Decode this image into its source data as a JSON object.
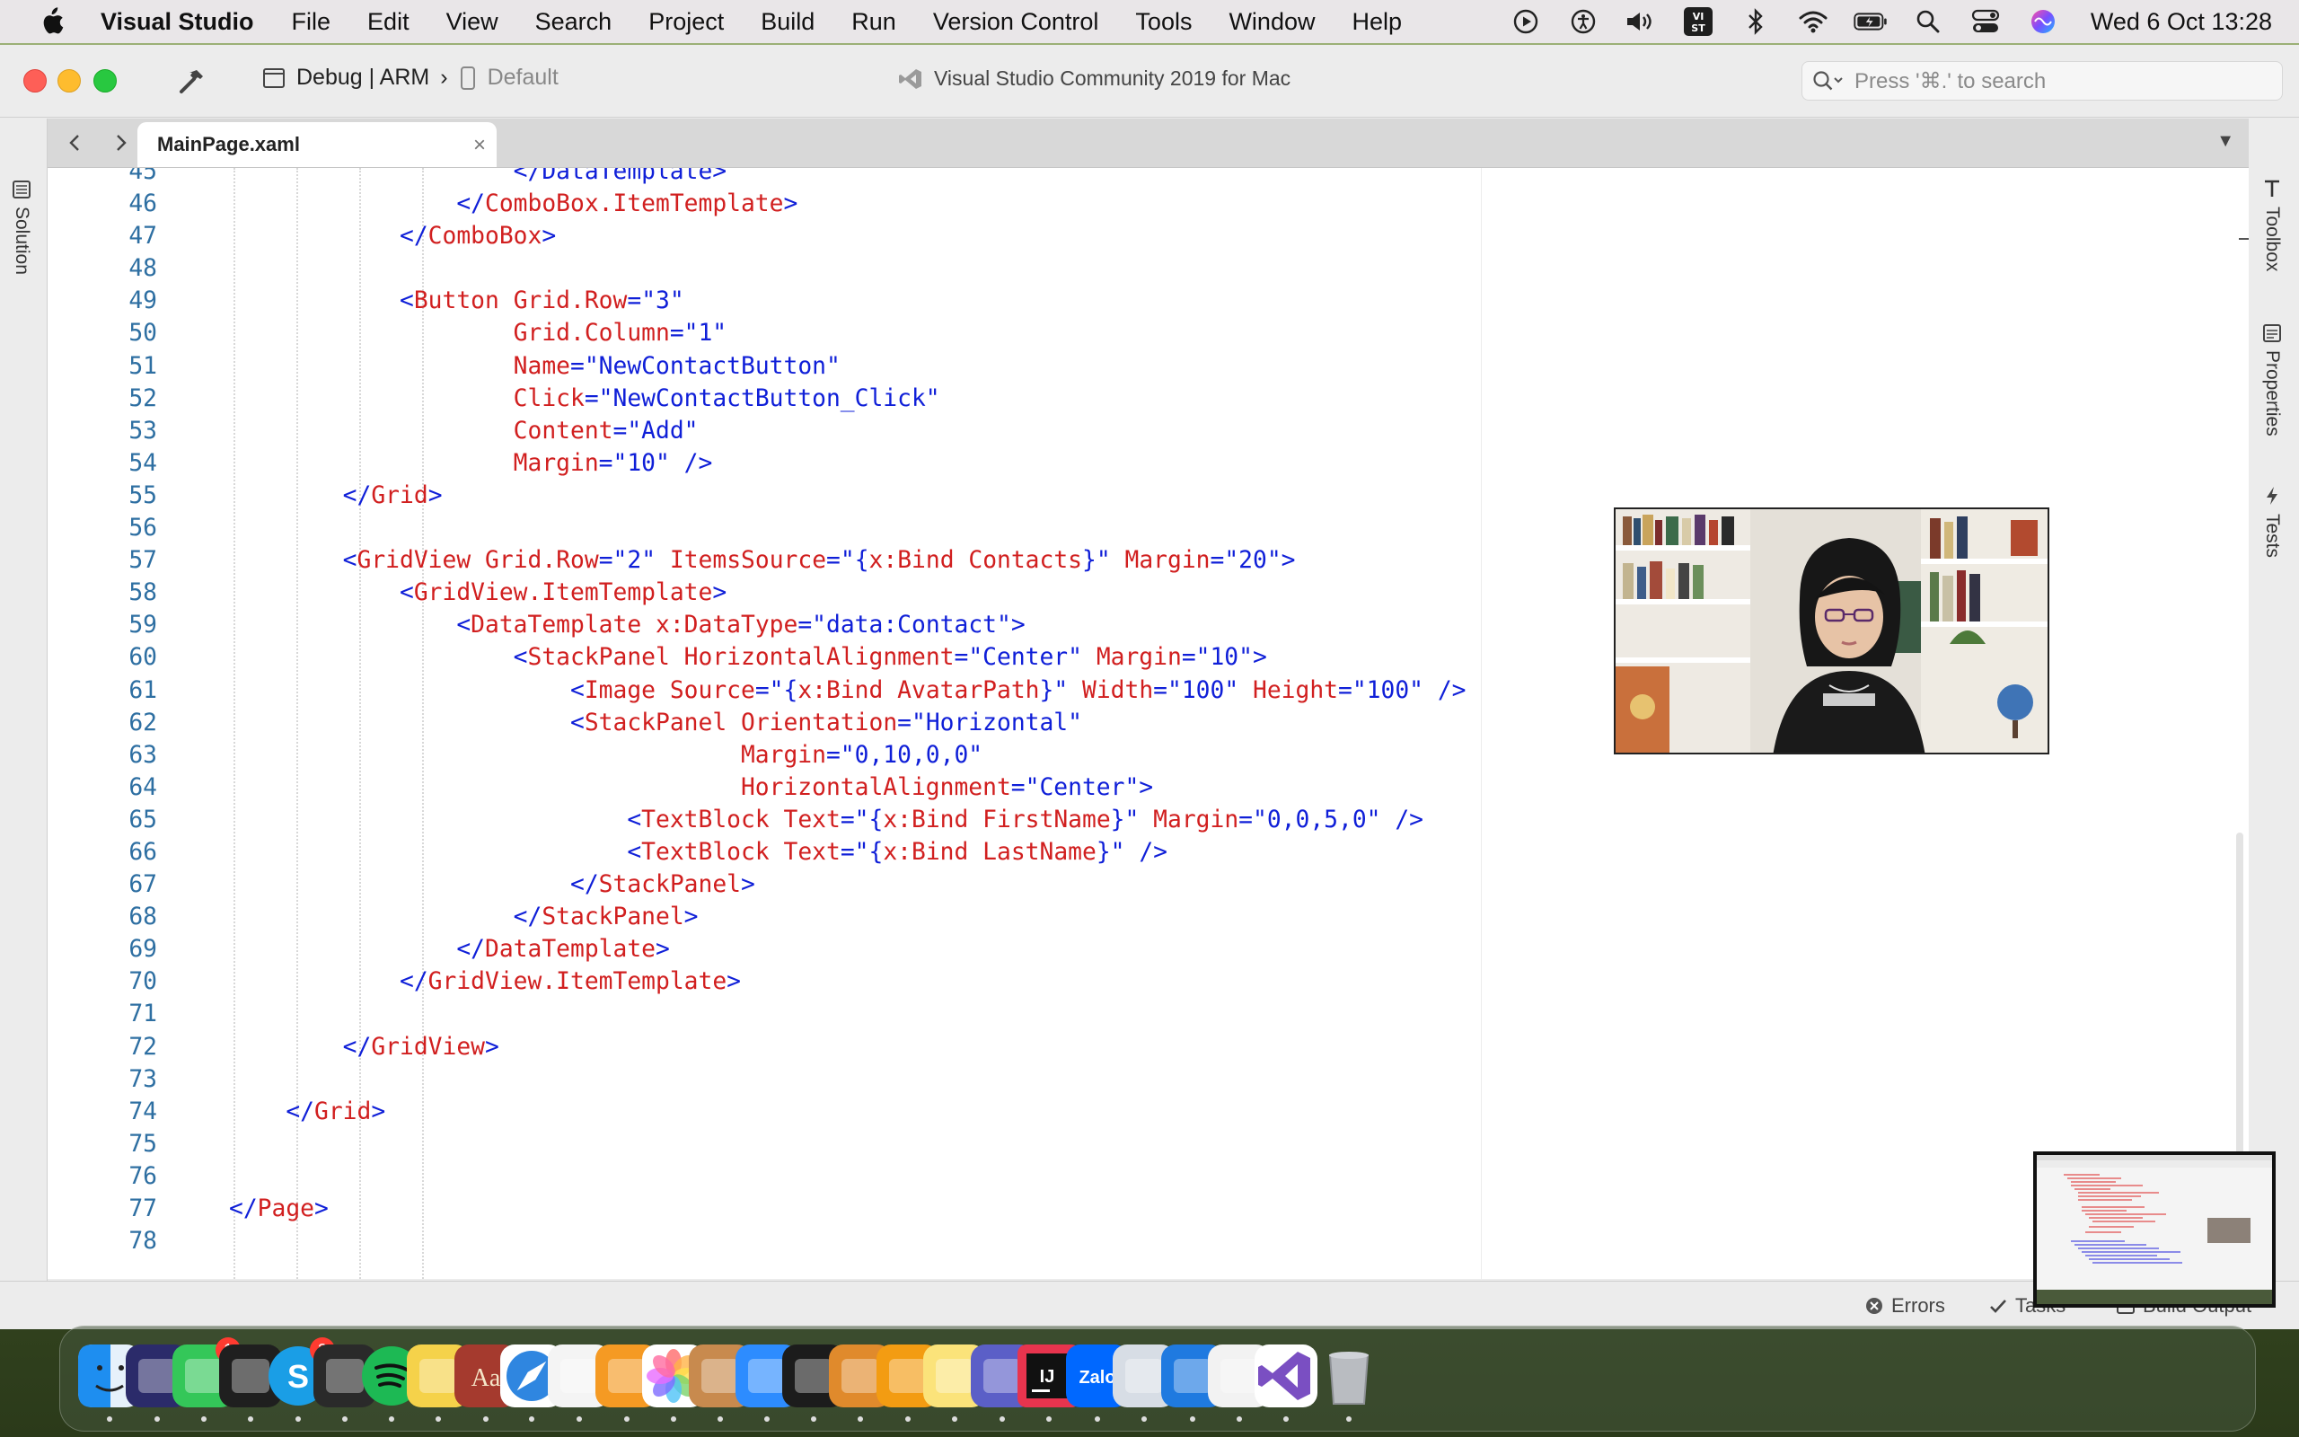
{
  "menubar": {
    "app_name": "Visual Studio",
    "items": [
      "File",
      "Edit",
      "View",
      "Search",
      "Project",
      "Build",
      "Run",
      "Version Control",
      "Tools",
      "Window",
      "Help"
    ],
    "status_icons": [
      "play-circle-icon",
      "accessibility-icon",
      "volume-icon",
      "vi-st-input-icon",
      "bluetooth-icon",
      "wifi-icon",
      "battery-icon",
      "spotlight-search-icon",
      "control-center-icon",
      "siri-icon"
    ],
    "input_badge": "VI\nST",
    "clock": "Wed 6 Oct  13:28"
  },
  "toolbar": {
    "configuration": "Debug | ARM",
    "config_arrow": "›",
    "device": "Default",
    "window_title": "Visual Studio Community 2019 for Mac",
    "search_placeholder": "Press '⌘.' to search"
  },
  "pads": {
    "left": "Solution",
    "right": [
      "Toolbox",
      "Properties",
      "Tests"
    ]
  },
  "tabs": {
    "active": "MainPage.xaml",
    "close_glyph": "×",
    "dropdown_glyph": "▼"
  },
  "editor": {
    "lines": [
      {
        "n": "45",
        "indent": 20,
        "tokens": [
          {
            "t": "tag",
            "s": "</DataTemplate>"
          }
        ]
      },
      {
        "n": "46",
        "indent": 16,
        "tokens": [
          {
            "t": "tag",
            "s": "</"
          },
          {
            "t": "attr",
            "s": "ComboBox.ItemTemplate"
          },
          {
            "t": "tag",
            "s": ">"
          }
        ]
      },
      {
        "n": "47",
        "indent": 12,
        "tokens": [
          {
            "t": "tag",
            "s": "</"
          },
          {
            "t": "attr",
            "s": "ComboBox"
          },
          {
            "t": "tag",
            "s": ">"
          }
        ]
      },
      {
        "n": "48",
        "indent": 0,
        "tokens": []
      },
      {
        "n": "49",
        "indent": 12,
        "tokens": [
          {
            "t": "tag",
            "s": "<"
          },
          {
            "t": "attr",
            "s": "Button"
          },
          {
            "t": "txt",
            "s": " "
          },
          {
            "t": "attr",
            "s": "Grid.Row"
          },
          {
            "t": "tag",
            "s": "=\"3\""
          }
        ]
      },
      {
        "n": "50",
        "indent": 20,
        "tokens": [
          {
            "t": "attr",
            "s": "Grid.Column"
          },
          {
            "t": "tag",
            "s": "=\"1\""
          }
        ]
      },
      {
        "n": "51",
        "indent": 20,
        "tokens": [
          {
            "t": "attr",
            "s": "Name"
          },
          {
            "t": "tag",
            "s": "=\"NewContactButton\""
          }
        ]
      },
      {
        "n": "52",
        "indent": 20,
        "tokens": [
          {
            "t": "attr",
            "s": "Click"
          },
          {
            "t": "tag",
            "s": "=\"NewContactButton_Click\""
          }
        ]
      },
      {
        "n": "53",
        "indent": 20,
        "tokens": [
          {
            "t": "attr",
            "s": "Content"
          },
          {
            "t": "tag",
            "s": "=\"Add\""
          }
        ]
      },
      {
        "n": "54",
        "indent": 20,
        "tokens": [
          {
            "t": "attr",
            "s": "Margin"
          },
          {
            "t": "tag",
            "s": "=\"10\" />"
          }
        ]
      },
      {
        "n": "55",
        "indent": 8,
        "tokens": [
          {
            "t": "tag",
            "s": "</"
          },
          {
            "t": "attr",
            "s": "Grid"
          },
          {
            "t": "tag",
            "s": ">"
          }
        ]
      },
      {
        "n": "56",
        "indent": 0,
        "tokens": []
      },
      {
        "n": "57",
        "indent": 8,
        "tokens": [
          {
            "t": "tag",
            "s": "<"
          },
          {
            "t": "attr",
            "s": "GridView"
          },
          {
            "t": "txt",
            "s": " "
          },
          {
            "t": "attr",
            "s": "Grid.Row"
          },
          {
            "t": "tag",
            "s": "=\"2\" "
          },
          {
            "t": "attr",
            "s": "ItemsSource"
          },
          {
            "t": "tag",
            "s": "=\"{"
          },
          {
            "t": "attr",
            "s": "x:Bind Contacts"
          },
          {
            "t": "tag",
            "s": "}\" "
          },
          {
            "t": "attr",
            "s": "Margin"
          },
          {
            "t": "tag",
            "s": "=\"20\">"
          }
        ]
      },
      {
        "n": "58",
        "indent": 12,
        "tokens": [
          {
            "t": "tag",
            "s": "<"
          },
          {
            "t": "attr",
            "s": "GridView.ItemTemplate"
          },
          {
            "t": "tag",
            "s": ">"
          }
        ]
      },
      {
        "n": "59",
        "indent": 16,
        "tokens": [
          {
            "t": "tag",
            "s": "<"
          },
          {
            "t": "attr",
            "s": "DataTemplate"
          },
          {
            "t": "txt",
            "s": " "
          },
          {
            "t": "attr",
            "s": "x:DataType"
          },
          {
            "t": "tag",
            "s": "=\"data:Contact\">"
          }
        ]
      },
      {
        "n": "60",
        "indent": 20,
        "tokens": [
          {
            "t": "tag",
            "s": "<"
          },
          {
            "t": "attr",
            "s": "StackPanel"
          },
          {
            "t": "txt",
            "s": " "
          },
          {
            "t": "attr",
            "s": "HorizontalAlignment"
          },
          {
            "t": "tag",
            "s": "=\"Center\" "
          },
          {
            "t": "attr",
            "s": "Margin"
          },
          {
            "t": "tag",
            "s": "=\"10\">"
          }
        ]
      },
      {
        "n": "61",
        "indent": 24,
        "tokens": [
          {
            "t": "tag",
            "s": "<"
          },
          {
            "t": "attr",
            "s": "Image"
          },
          {
            "t": "txt",
            "s": " "
          },
          {
            "t": "attr",
            "s": "Source"
          },
          {
            "t": "tag",
            "s": "=\"{"
          },
          {
            "t": "attr",
            "s": "x:Bind AvatarPath"
          },
          {
            "t": "tag",
            "s": "}\" "
          },
          {
            "t": "attr",
            "s": "Width"
          },
          {
            "t": "tag",
            "s": "=\"100\" "
          },
          {
            "t": "attr",
            "s": "Height"
          },
          {
            "t": "tag",
            "s": "=\"100\" />"
          }
        ]
      },
      {
        "n": "62",
        "indent": 24,
        "tokens": [
          {
            "t": "tag",
            "s": "<"
          },
          {
            "t": "attr",
            "s": "StackPanel"
          },
          {
            "t": "txt",
            "s": " "
          },
          {
            "t": "attr",
            "s": "Orientation"
          },
          {
            "t": "tag",
            "s": "=\"Horizontal\""
          }
        ]
      },
      {
        "n": "63",
        "indent": 36,
        "tokens": [
          {
            "t": "attr",
            "s": "Margin"
          },
          {
            "t": "tag",
            "s": "=\"0,10,0,0\""
          }
        ]
      },
      {
        "n": "64",
        "indent": 36,
        "tokens": [
          {
            "t": "attr",
            "s": "HorizontalAlignment"
          },
          {
            "t": "tag",
            "s": "=\"Center\">"
          }
        ]
      },
      {
        "n": "65",
        "indent": 28,
        "tokens": [
          {
            "t": "tag",
            "s": "<"
          },
          {
            "t": "attr",
            "s": "TextBlock"
          },
          {
            "t": "txt",
            "s": " "
          },
          {
            "t": "attr",
            "s": "Text"
          },
          {
            "t": "tag",
            "s": "=\"{"
          },
          {
            "t": "attr",
            "s": "x:Bind FirstName"
          },
          {
            "t": "tag",
            "s": "}\" "
          },
          {
            "t": "attr",
            "s": "Margin"
          },
          {
            "t": "tag",
            "s": "=\"0,0,5,0\" />"
          }
        ]
      },
      {
        "n": "66",
        "indent": 28,
        "tokens": [
          {
            "t": "tag",
            "s": "<"
          },
          {
            "t": "attr",
            "s": "TextBlock"
          },
          {
            "t": "txt",
            "s": " "
          },
          {
            "t": "attr",
            "s": "Text"
          },
          {
            "t": "tag",
            "s": "=\"{"
          },
          {
            "t": "attr",
            "s": "x:Bind LastName"
          },
          {
            "t": "tag",
            "s": "}\" />"
          }
        ]
      },
      {
        "n": "67",
        "indent": 24,
        "tokens": [
          {
            "t": "tag",
            "s": "</"
          },
          {
            "t": "attr",
            "s": "StackPanel"
          },
          {
            "t": "tag",
            "s": ">"
          }
        ]
      },
      {
        "n": "68",
        "indent": 20,
        "tokens": [
          {
            "t": "tag",
            "s": "</"
          },
          {
            "t": "attr",
            "s": "StackPanel"
          },
          {
            "t": "tag",
            "s": ">"
          }
        ]
      },
      {
        "n": "69",
        "indent": 16,
        "tokens": [
          {
            "t": "tag",
            "s": "</"
          },
          {
            "t": "attr",
            "s": "DataTemplate"
          },
          {
            "t": "tag",
            "s": ">"
          }
        ]
      },
      {
        "n": "70",
        "indent": 12,
        "tokens": [
          {
            "t": "tag",
            "s": "</"
          },
          {
            "t": "attr",
            "s": "GridView.ItemTemplate"
          },
          {
            "t": "tag",
            "s": ">"
          }
        ]
      },
      {
        "n": "71",
        "indent": 0,
        "tokens": []
      },
      {
        "n": "72",
        "indent": 8,
        "tokens": [
          {
            "t": "tag",
            "s": "</"
          },
          {
            "t": "attr",
            "s": "GridView"
          },
          {
            "t": "tag",
            "s": ">"
          }
        ]
      },
      {
        "n": "73",
        "indent": 0,
        "tokens": []
      },
      {
        "n": "74",
        "indent": 4,
        "tokens": [
          {
            "t": "tag",
            "s": "</"
          },
          {
            "t": "attr",
            "s": "Grid"
          },
          {
            "t": "tag",
            "s": ">"
          }
        ]
      },
      {
        "n": "75",
        "indent": 0,
        "tokens": []
      },
      {
        "n": "76",
        "indent": 0,
        "tokens": []
      },
      {
        "n": "77",
        "indent": 0,
        "tokens": [
          {
            "t": "tag",
            "s": "</"
          },
          {
            "t": "attr",
            "s": "Page"
          },
          {
            "t": "tag",
            "s": ">"
          }
        ]
      },
      {
        "n": "78",
        "indent": 0,
        "tokens": []
      }
    ]
  },
  "statusbar": {
    "errors": "Errors",
    "tasks": "Tasks",
    "build_output": "Build Output"
  },
  "dock": {
    "apps": [
      {
        "name": "finder-icon",
        "color": "#1e8ef0"
      },
      {
        "name": "siri-icon",
        "color": "#2b2b6a"
      },
      {
        "name": "messages-icon",
        "color": "#34c759",
        "badge": "1"
      },
      {
        "name": "terminal-icon",
        "color": "#1f1f1f"
      },
      {
        "name": "skype-icon",
        "color": "#1a9ee6",
        "badge": "3"
      },
      {
        "name": "quicktime-icon",
        "color": "#2a2a2a"
      },
      {
        "name": "spotify-icon",
        "color": "#1db954"
      },
      {
        "name": "cyberduck-icon",
        "color": "#f5d24a"
      },
      {
        "name": "dictionary-icon",
        "color": "#a53a2e"
      },
      {
        "name": "safari-icon",
        "color": "#2f86e0"
      },
      {
        "name": "numbers-icon",
        "color": "#f4f4f4"
      },
      {
        "name": "books-icon",
        "color": "#f59a23"
      },
      {
        "name": "photos-icon",
        "color": "#ffffff"
      },
      {
        "name": "archive-utility-icon",
        "color": "#c88a4e"
      },
      {
        "name": "zoom-icon",
        "color": "#2d8cff"
      },
      {
        "name": "activity-monitor-icon",
        "color": "#1c1c1c"
      },
      {
        "name": "reeder-icon",
        "color": "#e08a2c"
      },
      {
        "name": "pages-icon",
        "color": "#f39c12"
      },
      {
        "name": "notes-icon",
        "color": "#fbe37a"
      },
      {
        "name": "teams-icon",
        "color": "#5b5fc7"
      },
      {
        "name": "intellij-icon",
        "color": "#1a1a1a"
      },
      {
        "name": "zalo-icon",
        "color": "#0068ff"
      },
      {
        "name": "preview-icon",
        "color": "#d7dde5"
      },
      {
        "name": "keynote-icon",
        "color": "#1f7ae0"
      },
      {
        "name": "textedit-icon",
        "color": "#f2f2f2"
      },
      {
        "name": "visual-studio-icon",
        "color": "#7a4fc2"
      },
      {
        "name": "trash-icon",
        "color": "#b9bcc1"
      }
    ],
    "labels": {
      "zalo": "Zalo",
      "dictionary": "Aa",
      "intellij": "IJ",
      "skype": "S"
    }
  }
}
